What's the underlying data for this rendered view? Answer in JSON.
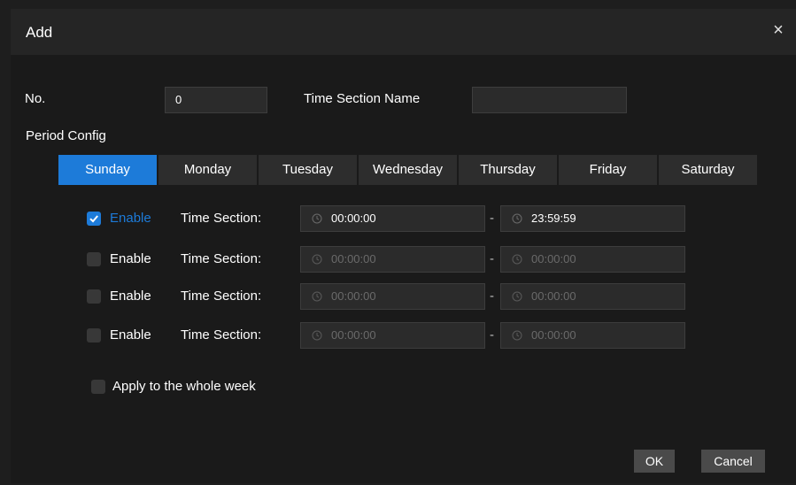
{
  "dialog": {
    "title": "Add",
    "close_glyph": "×"
  },
  "form": {
    "no_label": "No.",
    "no_value": "0",
    "name_label": "Time Section Name",
    "name_value": "",
    "period_label": "Period Config"
  },
  "tabs": [
    "Sunday",
    "Monday",
    "Tuesday",
    "Wednesday",
    "Thursday",
    "Friday",
    "Saturday"
  ],
  "active_tab": "Sunday",
  "sections": [
    {
      "enable_label": "Enable",
      "checked": true,
      "time_label": "Time Section:",
      "start": "00:00:00",
      "end": "23:59:59"
    },
    {
      "enable_label": "Enable",
      "checked": false,
      "time_label": "Time Section:",
      "start": "00:00:00",
      "end": "00:00:00"
    },
    {
      "enable_label": "Enable",
      "checked": false,
      "time_label": "Time Section:",
      "start": "00:00:00",
      "end": "00:00:00"
    },
    {
      "enable_label": "Enable",
      "checked": false,
      "time_label": "Time Section:",
      "start": "00:00:00",
      "end": "00:00:00"
    }
  ],
  "separator": "-",
  "apply_week_label": "Apply to the whole week",
  "buttons": {
    "ok": "OK",
    "cancel": "Cancel"
  },
  "colors": {
    "accent": "#1d7bd9",
    "background": "#1a1a1a",
    "titlebar": "#252525"
  },
  "icons": {
    "close": "close-icon",
    "check": "checkmark-icon",
    "clock": "clock-icon"
  }
}
